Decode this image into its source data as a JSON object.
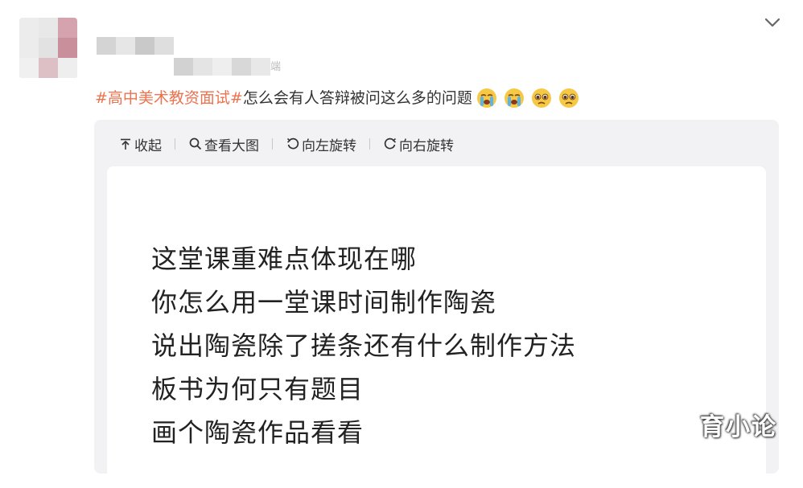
{
  "post": {
    "author_source_suffix": "端",
    "topic": "#高中美术教资面试#",
    "text": "怎么会有人答辩被问这么多的问题",
    "emoticons": [
      "crying-face-icon",
      "crying-face-icon",
      "pleading-face-icon",
      "pleading-face-icon"
    ]
  },
  "toolbar": {
    "collapse": "收起",
    "view_large": "查看大图",
    "rotate_left": "向左旋转",
    "rotate_right": "向右旋转"
  },
  "image": {
    "lines": [
      "这堂课重难点体现在哪",
      "你怎么用一堂课时间制作陶瓷",
      "说出陶瓷除了搓条还有什么制作方法",
      "板书为何只有题目",
      "画个陶瓷作品看看"
    ],
    "watermark": "育小论"
  },
  "colors": {
    "topic": "#eb7350",
    "card_bg": "#f2f2f5"
  }
}
